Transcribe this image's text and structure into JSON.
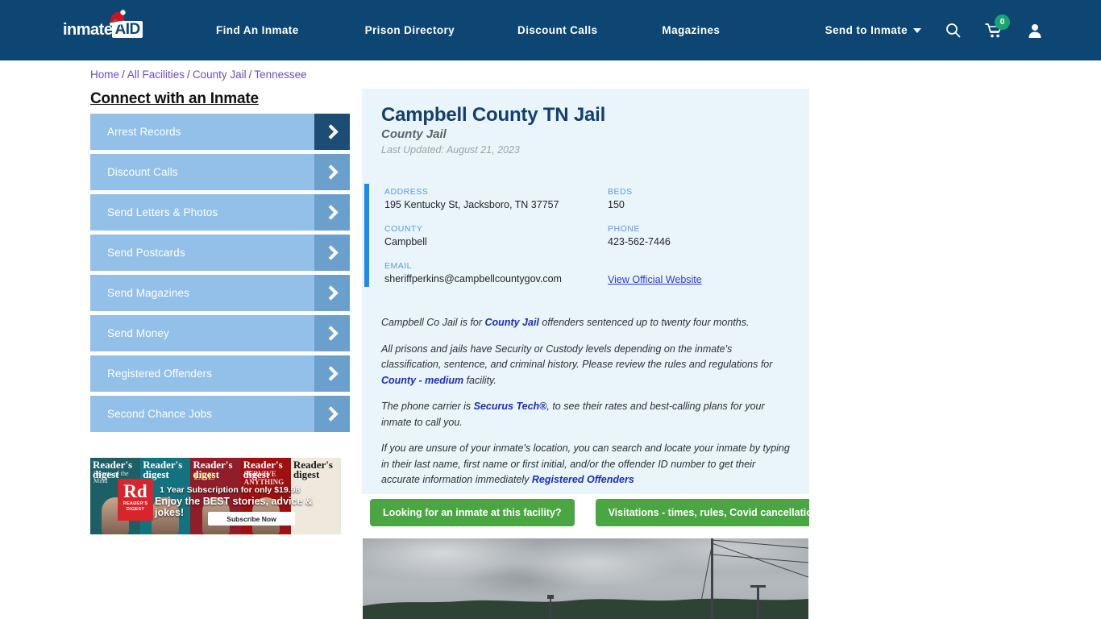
{
  "nav": {
    "logo": {
      "text_main": "inmate",
      "text_box": "AID",
      "hat": "santa-hat"
    },
    "links": [
      {
        "label": "Find An Inmate"
      },
      {
        "label": "Prison Directory"
      },
      {
        "label": "Discount Calls"
      },
      {
        "label": "Magazines"
      }
    ],
    "send_to_inmate": "Send to Inmate",
    "cart_count": "0",
    "icons": {
      "search": "search-icon",
      "cart": "cart-icon",
      "user": "user-account-icon"
    }
  },
  "breadcrumb": {
    "items": [
      "Home",
      "All Facilities",
      "County Jail",
      "Tennessee"
    ],
    "separator": "/"
  },
  "sidebar": {
    "title": "Connect with an Inmate",
    "items": [
      {
        "label": "Arrest Records",
        "active": true
      },
      {
        "label": "Discount Calls",
        "active": false
      },
      {
        "label": "Send Letters & Photos",
        "active": false
      },
      {
        "label": "Send Postcards",
        "active": false
      },
      {
        "label": "Send Magazines",
        "active": false
      },
      {
        "label": "Send Money",
        "active": false
      },
      {
        "label": "Registered Offenders",
        "active": false
      },
      {
        "label": "Second Chance Jobs",
        "active": false
      }
    ]
  },
  "ad": {
    "brand": "Reader's Digest",
    "rd_mark": "Rd",
    "rd_sub1": "READER'S",
    "rd_sub2": "DIGEST",
    "line1": "1 Year Subscription for only $19.98",
    "line2": "Enjoy the BEST stories, advice & jokes!",
    "button": "Subscribe Now",
    "covers": [
      {
        "title": "Reader's digest",
        "sub": "Secrets of the Mind"
      },
      {
        "title": "Reader's digest",
        "sub": ""
      },
      {
        "title": "Reader's digest",
        "sub": "LEE"
      },
      {
        "title": "Reader's digest",
        "sub": "SURVIVE ANYTHING"
      },
      {
        "title": "Reader's digest",
        "sub": ""
      }
    ]
  },
  "facility": {
    "title": "Campbell County TN Jail",
    "subtitle": "County Jail",
    "last_updated": "Last Updated: August 21, 2023",
    "info": [
      {
        "key": "ADDRESS",
        "value": "195 Kentucky St, Jacksboro, TN 37757",
        "type": "text"
      },
      {
        "key": "BEDS",
        "value": "150",
        "type": "text"
      },
      {
        "key": "COUNTY",
        "value": "Campbell",
        "type": "text"
      },
      {
        "key": "PHONE",
        "value": "423-562-7446",
        "type": "text"
      },
      {
        "key": "EMAIL",
        "value": "sheriffperkins@campbellcountygov.com",
        "type": "text"
      },
      {
        "key": "",
        "value": "View Official Website",
        "type": "link"
      }
    ],
    "paragraphs": [
      [
        {
          "t": "Campbell Co Jail is for ",
          "link": false
        },
        {
          "t": "County Jail",
          "link": true
        },
        {
          "t": " offenders sentenced up to twenty four months.",
          "link": false
        }
      ],
      [
        {
          "t": "All prisons and jails have Security or Custody levels depending on the inmate's classification, sentence, and criminal history. Please review the rules and regulations for ",
          "link": false
        },
        {
          "t": "County - medium",
          "link": true
        },
        {
          "t": " facility.",
          "link": false
        }
      ],
      [
        {
          "t": "The phone carrier is ",
          "link": false
        },
        {
          "t": "Securus Tech®",
          "link": true
        },
        {
          "t": ", to see their rates and best-calling plans for your inmate to call you.",
          "link": false
        }
      ],
      [
        {
          "t": "If you are unsure of your inmate's location, you can search and locate your inmate by typing in their last name, first name or first initial, and/or the offender ID number to get their accurate information immediately ",
          "link": false
        },
        {
          "t": "Registered Offenders",
          "link": true
        }
      ]
    ]
  },
  "cta": {
    "buttons": [
      {
        "label": "Looking for an inmate at this facility?"
      },
      {
        "label": "Visitations - times, rules, Covid cancellations"
      }
    ]
  },
  "photo": {
    "alt": "facility-exterior-photo"
  },
  "colors": {
    "nav_bg": "#0d4673",
    "panel_bg": "#eaf4fb",
    "accent_blue": "#1a8ceb",
    "sidebar_item": "#93c0e8",
    "sidebar_arrow": "#6b9fcc",
    "sidebar_arrow_active": "#1d4d74",
    "cta_green": "#4aa543",
    "badge_green": "#17a673",
    "link_purple": "#6b4fbb",
    "title_navy": "#123f6e"
  }
}
